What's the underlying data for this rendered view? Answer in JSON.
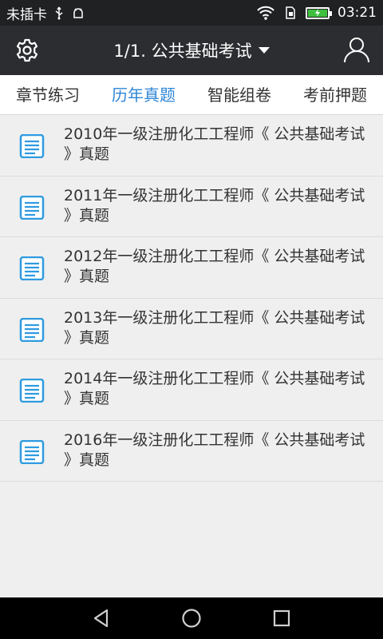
{
  "status_bar": {
    "carrier_text": "未插卡",
    "time": "03:21",
    "icons": [
      "usb-icon",
      "android-debug-icon",
      "wifi-icon",
      "sim-icon",
      "battery-charging-icon"
    ]
  },
  "app_bar": {
    "title": "1/1. 公共基础考试",
    "left_icon": "gear-icon",
    "right_icon": "user-icon",
    "dropdown_icon": "caret-down-icon"
  },
  "tabs": [
    {
      "label": "章节练习",
      "active": false
    },
    {
      "label": "历年真题",
      "active": true
    },
    {
      "label": "智能组卷",
      "active": false
    },
    {
      "label": "考前押题",
      "active": false
    }
  ],
  "exam_list": [
    {
      "title": "2010年一级注册化工工程师《 公共基础考试 》真题"
    },
    {
      "title": "2011年一级注册化工工程师《 公共基础考试 》真题"
    },
    {
      "title": "2012年一级注册化工工程师《 公共基础考试 》真题"
    },
    {
      "title": "2013年一级注册化工工程师《 公共基础考试 》真题"
    },
    {
      "title": "2014年一级注册化工工程师《 公共基础考试 》真题"
    },
    {
      "title": "2016年一级注册化工工程师《 公共基础考试 》真题"
    }
  ],
  "nav_bar": {
    "icons": [
      "back-icon",
      "home-icon",
      "recents-icon"
    ]
  },
  "colors": {
    "accent": "#2f86d6",
    "app_bar_bg": "#2b2d30",
    "status_bar_bg": "#1f2123",
    "list_bg": "#efefef",
    "doc_icon": "#2f9be0"
  }
}
